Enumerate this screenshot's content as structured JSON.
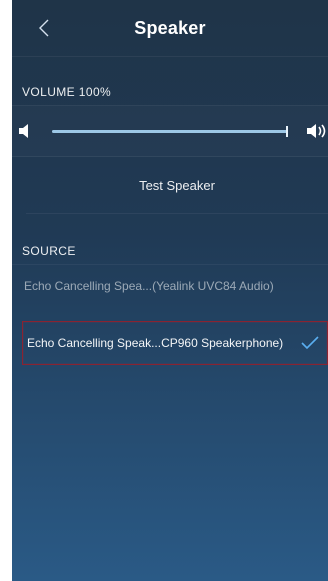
{
  "header": {
    "title": "Speaker",
    "back_icon": "chevron-left-icon"
  },
  "volume": {
    "label": "VOLUME 100%",
    "level_percent": 100,
    "min_icon": "speaker-low-icon",
    "max_icon": "speaker-high-icon",
    "fill_color": "#9cc7e6"
  },
  "test": {
    "label": "Test Speaker"
  },
  "source": {
    "label": "SOURCE",
    "items": [
      {
        "label": "Echo Cancelling Spea...(Yealink UVC84 Audio)",
        "selected": false
      },
      {
        "label": "Echo Cancelling Speak...CP960 Speakerphone)",
        "selected": true
      }
    ],
    "check_icon": "checkmark-icon",
    "accent_color": "#5aaef0"
  }
}
